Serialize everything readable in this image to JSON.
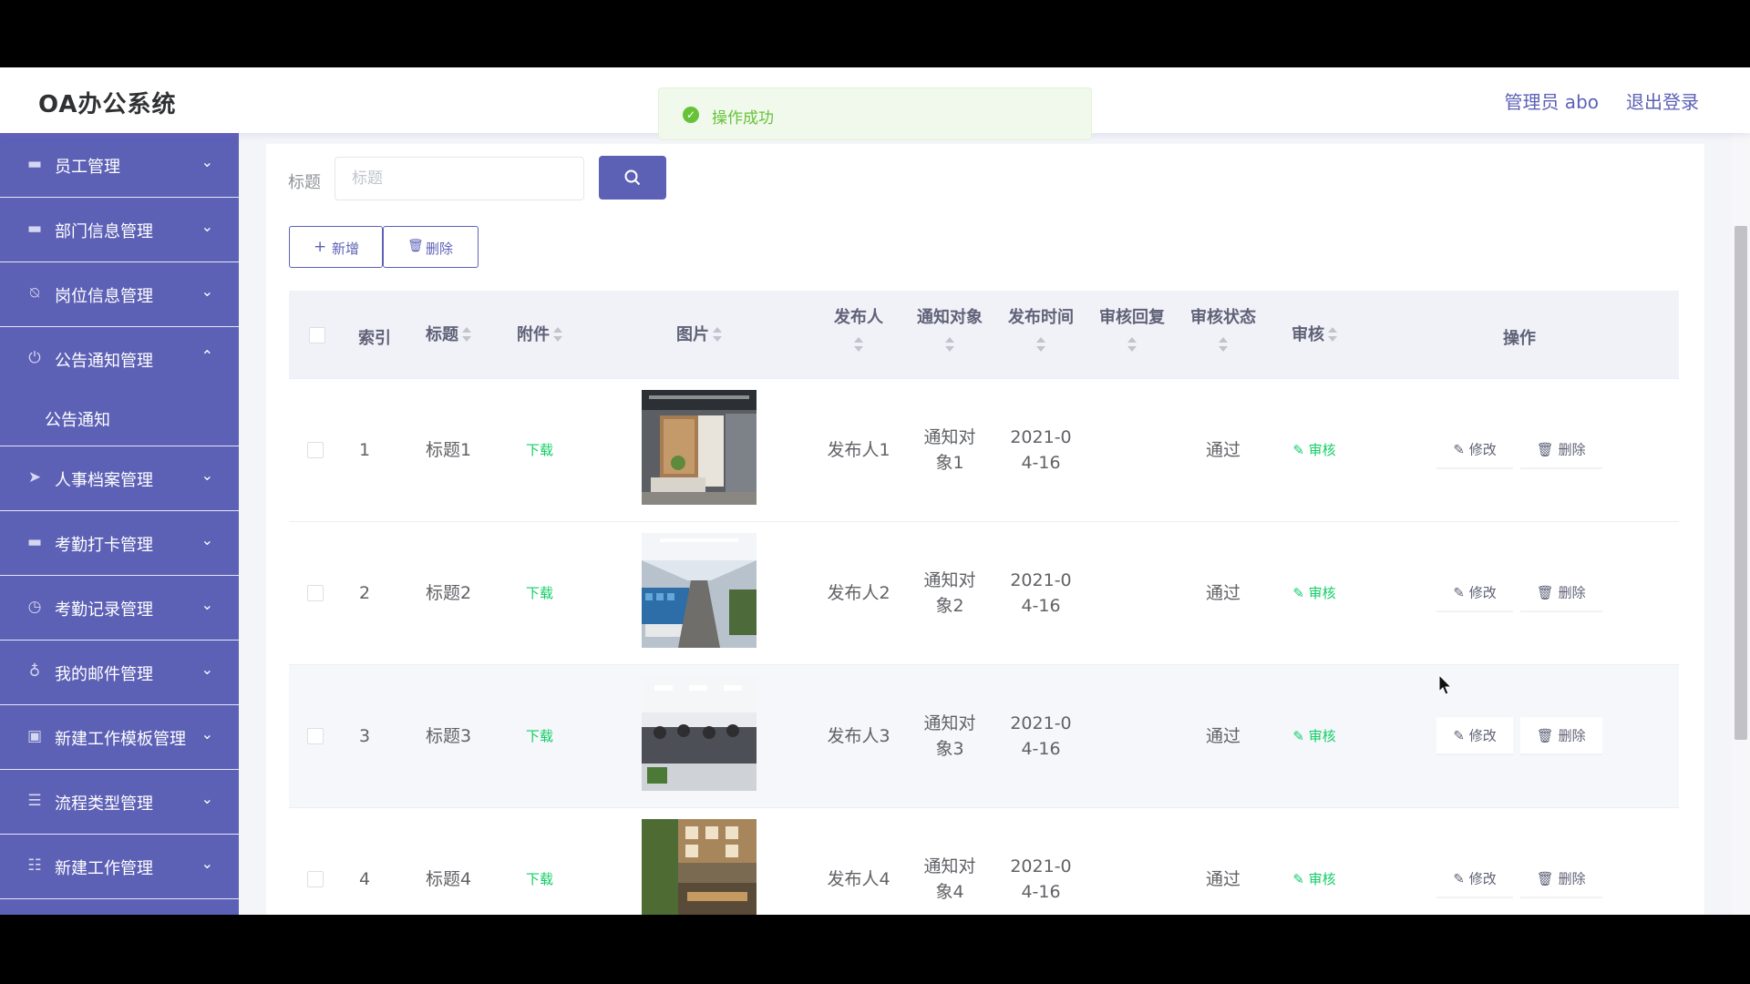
{
  "app": {
    "title": "OA办公系统",
    "user": "管理员 abo",
    "logout": "退出登录"
  },
  "toast": {
    "message": "操作成功",
    "color": "#67c23a"
  },
  "colors": {
    "accent": "#5d61b6",
    "success": "#13ce66"
  },
  "sidebar": {
    "items": [
      {
        "label": "员工管理",
        "icon": "user-icon"
      },
      {
        "label": "部门信息管理",
        "icon": "monitor-icon"
      },
      {
        "label": "岗位信息管理",
        "icon": "bell-off-icon"
      },
      {
        "label": "公告通知管理",
        "icon": "power-icon",
        "expanded": true
      },
      {
        "label": "人事档案管理",
        "icon": "send-icon"
      },
      {
        "label": "考勤打卡管理",
        "icon": "monitor-icon"
      },
      {
        "label": "考勤记录管理",
        "icon": "clock-icon"
      },
      {
        "label": "我的邮件管理",
        "icon": "mic-icon"
      },
      {
        "label": "新建工作模板管理",
        "icon": "trash-icon"
      },
      {
        "label": "流程类型管理",
        "icon": "list-icon"
      },
      {
        "label": "新建工作管理",
        "icon": "sliders-icon"
      }
    ],
    "subitem": "公告通知"
  },
  "search": {
    "label": "标题",
    "placeholder": "标题"
  },
  "toolbar": {
    "add": "新增",
    "delete": "删除"
  },
  "table": {
    "headers": {
      "index": "索引",
      "title": "标题",
      "attachment": "附件",
      "image": "图片",
      "publisher": "发布人",
      "target": "通知对象",
      "time": "发布时间",
      "reply": "审核回复",
      "status": "审核状态",
      "review": "审核",
      "ops": "操作"
    },
    "rows": [
      {
        "index": "1",
        "title": "标题1",
        "attachment": "下载",
        "publisher": "发布人1",
        "target": "通知对象1",
        "time": "2021-04-16",
        "reply": "",
        "status": "通过",
        "review": "审核",
        "edit": "修改",
        "delete": "删除"
      },
      {
        "index": "2",
        "title": "标题2",
        "attachment": "下载",
        "publisher": "发布人2",
        "target": "通知对象2",
        "time": "2021-04-16",
        "reply": "",
        "status": "通过",
        "review": "审核",
        "edit": "修改",
        "delete": "删除"
      },
      {
        "index": "3",
        "title": "标题3",
        "attachment": "下载",
        "publisher": "发布人3",
        "target": "通知对象3",
        "time": "2021-04-16",
        "reply": "",
        "status": "通过",
        "review": "审核",
        "edit": "修改",
        "delete": "删除"
      },
      {
        "index": "4",
        "title": "标题4",
        "attachment": "下载",
        "publisher": "发布人4",
        "target": "通知对象4",
        "time": "2021-04-16",
        "reply": "",
        "status": "通过",
        "review": "审核",
        "edit": "修改",
        "delete": "删除"
      }
    ]
  }
}
